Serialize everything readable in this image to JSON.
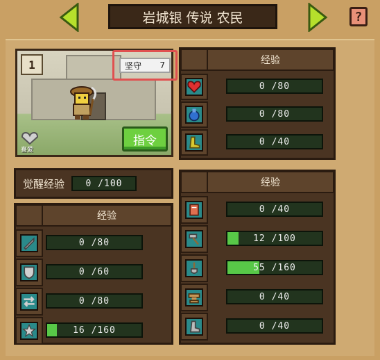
{
  "header": {
    "title": "岩城银 传说 农民",
    "help_glyph": "?"
  },
  "character": {
    "badge": "1",
    "trait_name": "坚守",
    "trait_value": "7",
    "command_label": "指令",
    "like_label": "喜爱"
  },
  "stats_panel": {
    "header": "经验",
    "rows": [
      {
        "icon": "heart-icon",
        "color": "#e03030",
        "value": "0 /80",
        "progress": 0
      },
      {
        "icon": "potion-icon",
        "color": "#3070d0",
        "value": "0 /80",
        "progress": 0
      },
      {
        "icon": "boot-icon",
        "color": "#d8c830",
        "value": "0 /40",
        "progress": 0
      }
    ]
  },
  "awaken": {
    "label": "觉醒经验",
    "value": "0 /100",
    "progress": 0
  },
  "combat_panel": {
    "header": "经验",
    "rows": [
      {
        "icon": "sword-icon",
        "value": "0 /80",
        "progress": 0
      },
      {
        "icon": "shield-icon",
        "value": "0 /60",
        "progress": 0
      },
      {
        "icon": "arrows-icon",
        "value": "0 /80",
        "progress": 0
      },
      {
        "icon": "star-icon",
        "value": "16 /160",
        "progress": 0.1
      }
    ]
  },
  "skills_panel": {
    "header": "经验",
    "rows": [
      {
        "icon": "book-icon",
        "value": "0 /40",
        "progress": 0
      },
      {
        "icon": "hammer-icon",
        "value": "12 /100",
        "progress": 0.12
      },
      {
        "icon": "shovel-icon",
        "value": "55 /160",
        "progress": 0.34
      },
      {
        "icon": "anvil-icon",
        "value": "0 /40",
        "progress": 0
      },
      {
        "icon": "boot-metal-icon",
        "value": "0 /40",
        "progress": 0
      }
    ]
  }
}
